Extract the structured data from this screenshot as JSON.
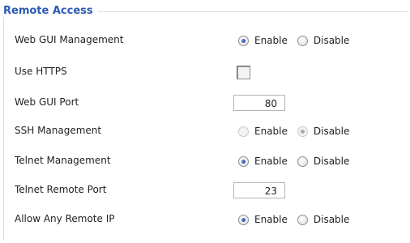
{
  "section": {
    "title": "Remote Access"
  },
  "rows": [
    {
      "label": "Web GUI Management",
      "type": "radio",
      "options": [
        "Enable",
        "Disable"
      ],
      "selected": "Enable",
      "disabled": false
    },
    {
      "label": "Use HTTPS",
      "type": "checkbox",
      "checked": false
    },
    {
      "label": "Web GUI Port",
      "type": "text",
      "value": "80"
    },
    {
      "label": "SSH Management",
      "type": "radio",
      "options": [
        "Enable",
        "Disable"
      ],
      "selected": "Disable",
      "disabled": true
    },
    {
      "label": "Telnet Management",
      "type": "radio",
      "options": [
        "Enable",
        "Disable"
      ],
      "selected": "Enable",
      "disabled": false
    },
    {
      "label": "Telnet Remote Port",
      "type": "text",
      "value": "23"
    },
    {
      "label": "Allow Any Remote IP",
      "type": "radio",
      "options": [
        "Enable",
        "Disable"
      ],
      "selected": "Enable",
      "disabled": false
    }
  ],
  "colors": {
    "legend": "#2c5bb3",
    "text": "#222222",
    "border": "#dcdcdc"
  }
}
